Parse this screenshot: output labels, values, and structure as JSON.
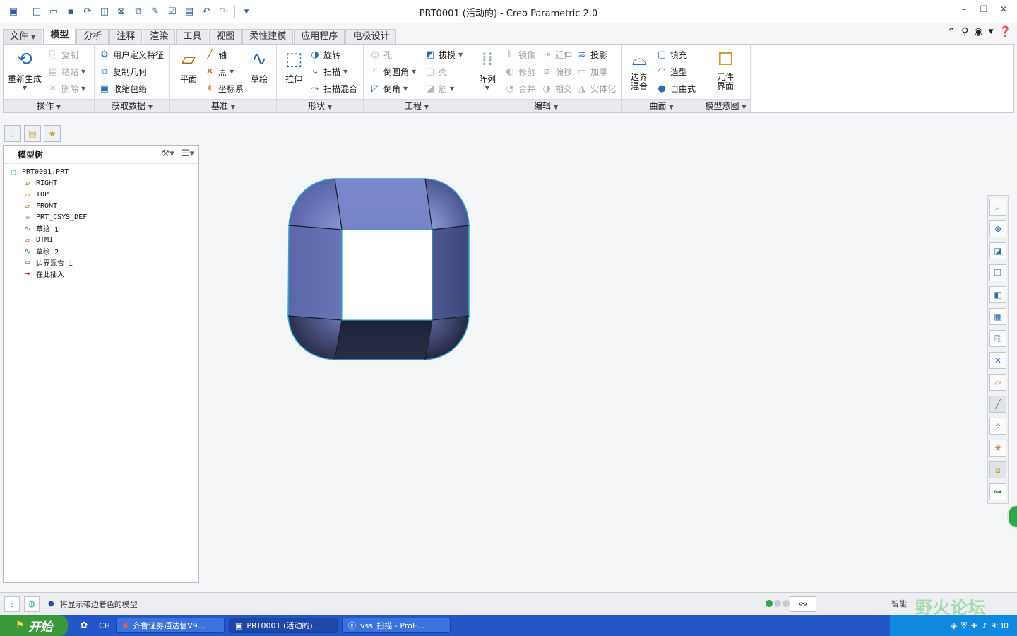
{
  "window": {
    "title": "PRT0001 (活动的) - Creo Parametric 2.0"
  },
  "quick_access": [
    "new-icon",
    "open-icon",
    "save-icon",
    "regenerate-icon",
    "window-icon",
    "close-icon",
    "undo-icon",
    "redo-icon"
  ],
  "tabs": [
    "文件",
    "模型",
    "分析",
    "注释",
    "渲染",
    "工具",
    "视图",
    "柔性建模",
    "应用程序",
    "电极设计"
  ],
  "ribbon": {
    "operations": {
      "label": "操作",
      "regenerate": "重新生成",
      "copy": "复制",
      "paste": "粘贴",
      "delete": "删除"
    },
    "get_data": {
      "label": "获取数据",
      "udf": "用户定义特征",
      "copy_geom": "复制几何",
      "shrinkwrap": "收缩包络"
    },
    "datum": {
      "label": "基准",
      "plane": "平面",
      "axis": "轴",
      "point": "点",
      "csys": "坐标系",
      "sketch": "草绘"
    },
    "shapes": {
      "label": "形状",
      "extrude": "拉伸",
      "revolve": "旋转",
      "sweep": "扫描",
      "swept_blend": "扫描混合"
    },
    "engineering": {
      "label": "工程",
      "hole": "孔",
      "draft": "拔模",
      "round": "倒圆角",
      "shell": "壳",
      "chamfer": "倒角",
      "rib": "筋"
    },
    "editing": {
      "label": "编辑",
      "pattern": "阵列",
      "mirror": "镜像",
      "extend": "延伸",
      "project": "投影",
      "trim": "修剪",
      "offset": "偏移",
      "thicken": "加厚",
      "merge": "合并",
      "intersect": "相交",
      "solidify": "实体化"
    },
    "surfaces": {
      "label": "曲面",
      "boundary_blend": "边界混合",
      "fill": "填充",
      "style": "造型",
      "freestyle": "自由式"
    },
    "model_intent": {
      "label": "模型意图",
      "component_interface": "元件界面"
    }
  },
  "model_tree": {
    "title": "模型树",
    "root": "PRT0001.PRT",
    "items": [
      {
        "label": "RIGHT",
        "icon": "datum-plane-icon"
      },
      {
        "label": "TOP",
        "icon": "datum-plane-icon"
      },
      {
        "label": "FRONT",
        "icon": "datum-plane-icon"
      },
      {
        "label": "PRT_CSYS_DEF",
        "icon": "csys-icon"
      },
      {
        "label": "草绘 1",
        "icon": "sketch-icon"
      },
      {
        "label": "DTM1",
        "icon": "datum-plane-icon"
      },
      {
        "label": "草绘 2",
        "icon": "sketch-icon"
      },
      {
        "label": "边界混合 1",
        "icon": "boundary-blend-icon"
      },
      {
        "label": "在此插入",
        "icon": "insert-here-icon"
      }
    ]
  },
  "status": {
    "message": "将显示带边着色的模型",
    "selection_filter": "智能"
  },
  "watermark": "野火论坛",
  "taskbar": {
    "start": "开始",
    "lang": "CH",
    "tasks": [
      "齐鲁证券通达信V9...",
      "PRT0001 (活动的)...",
      "vss_扫描 - ProE..."
    ],
    "clock": "9:30"
  },
  "colors": {
    "model_face": "#7a86cc",
    "model_dark": "#22253a",
    "model_edge": "#2ea6c9",
    "accent": "#2b6cb0"
  }
}
